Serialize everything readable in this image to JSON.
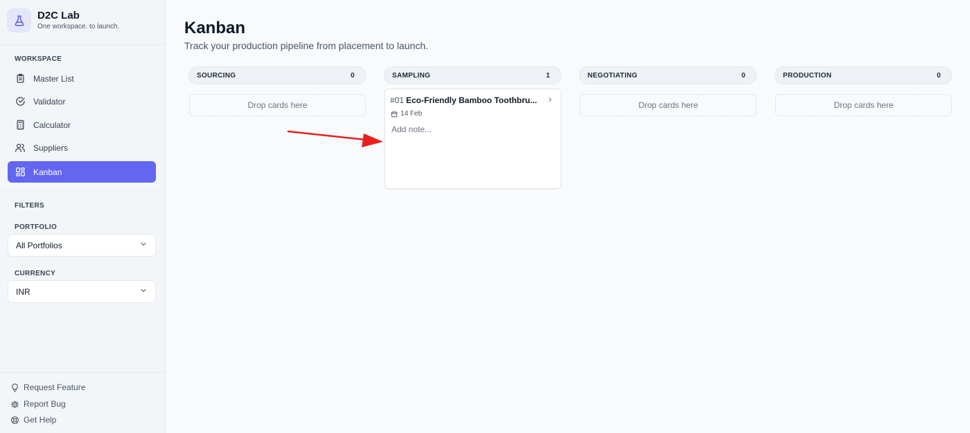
{
  "brand": {
    "name": "D2C Lab",
    "tagline": "One workspace. to launch."
  },
  "sidebar": {
    "workspace_label": "WORKSPACE",
    "items": [
      {
        "label": "Master List",
        "icon": "clipboard-icon"
      },
      {
        "label": "Validator",
        "icon": "check-circle-icon"
      },
      {
        "label": "Calculator",
        "icon": "calculator-icon"
      },
      {
        "label": "Suppliers",
        "icon": "users-icon"
      },
      {
        "label": "Kanban",
        "icon": "kanban-icon",
        "active": true
      }
    ],
    "filters_label": "FILTERS",
    "portfolio": {
      "label": "PORTFOLIO",
      "value": "All Portfolios"
    },
    "currency": {
      "label": "CURRENCY",
      "value": "INR"
    },
    "footer": [
      {
        "label": "Request Feature",
        "icon": "lightbulb-icon"
      },
      {
        "label": "Report Bug",
        "icon": "bug-icon"
      },
      {
        "label": "Get Help",
        "icon": "help-icon"
      }
    ]
  },
  "main": {
    "title": "Kanban",
    "subtitle": "Track your production pipeline from placement to launch.",
    "columns": [
      {
        "name": "SOURCING",
        "count": "0",
        "empty_text": "Drop cards here"
      },
      {
        "name": "SAMPLING",
        "count": "1"
      },
      {
        "name": "NEGOTIATING",
        "count": "0",
        "empty_text": "Drop cards here"
      },
      {
        "name": "PRODUCTION",
        "count": "0",
        "empty_text": "Drop cards here"
      }
    ],
    "card": {
      "id": "#01",
      "title": "Eco-Friendly Bamboo Toothbru...",
      "date": "14 Feb",
      "note_placeholder": "Add note..."
    }
  },
  "colors": {
    "accent": "#6366f1",
    "annotation_arrow": "#e8201e"
  }
}
